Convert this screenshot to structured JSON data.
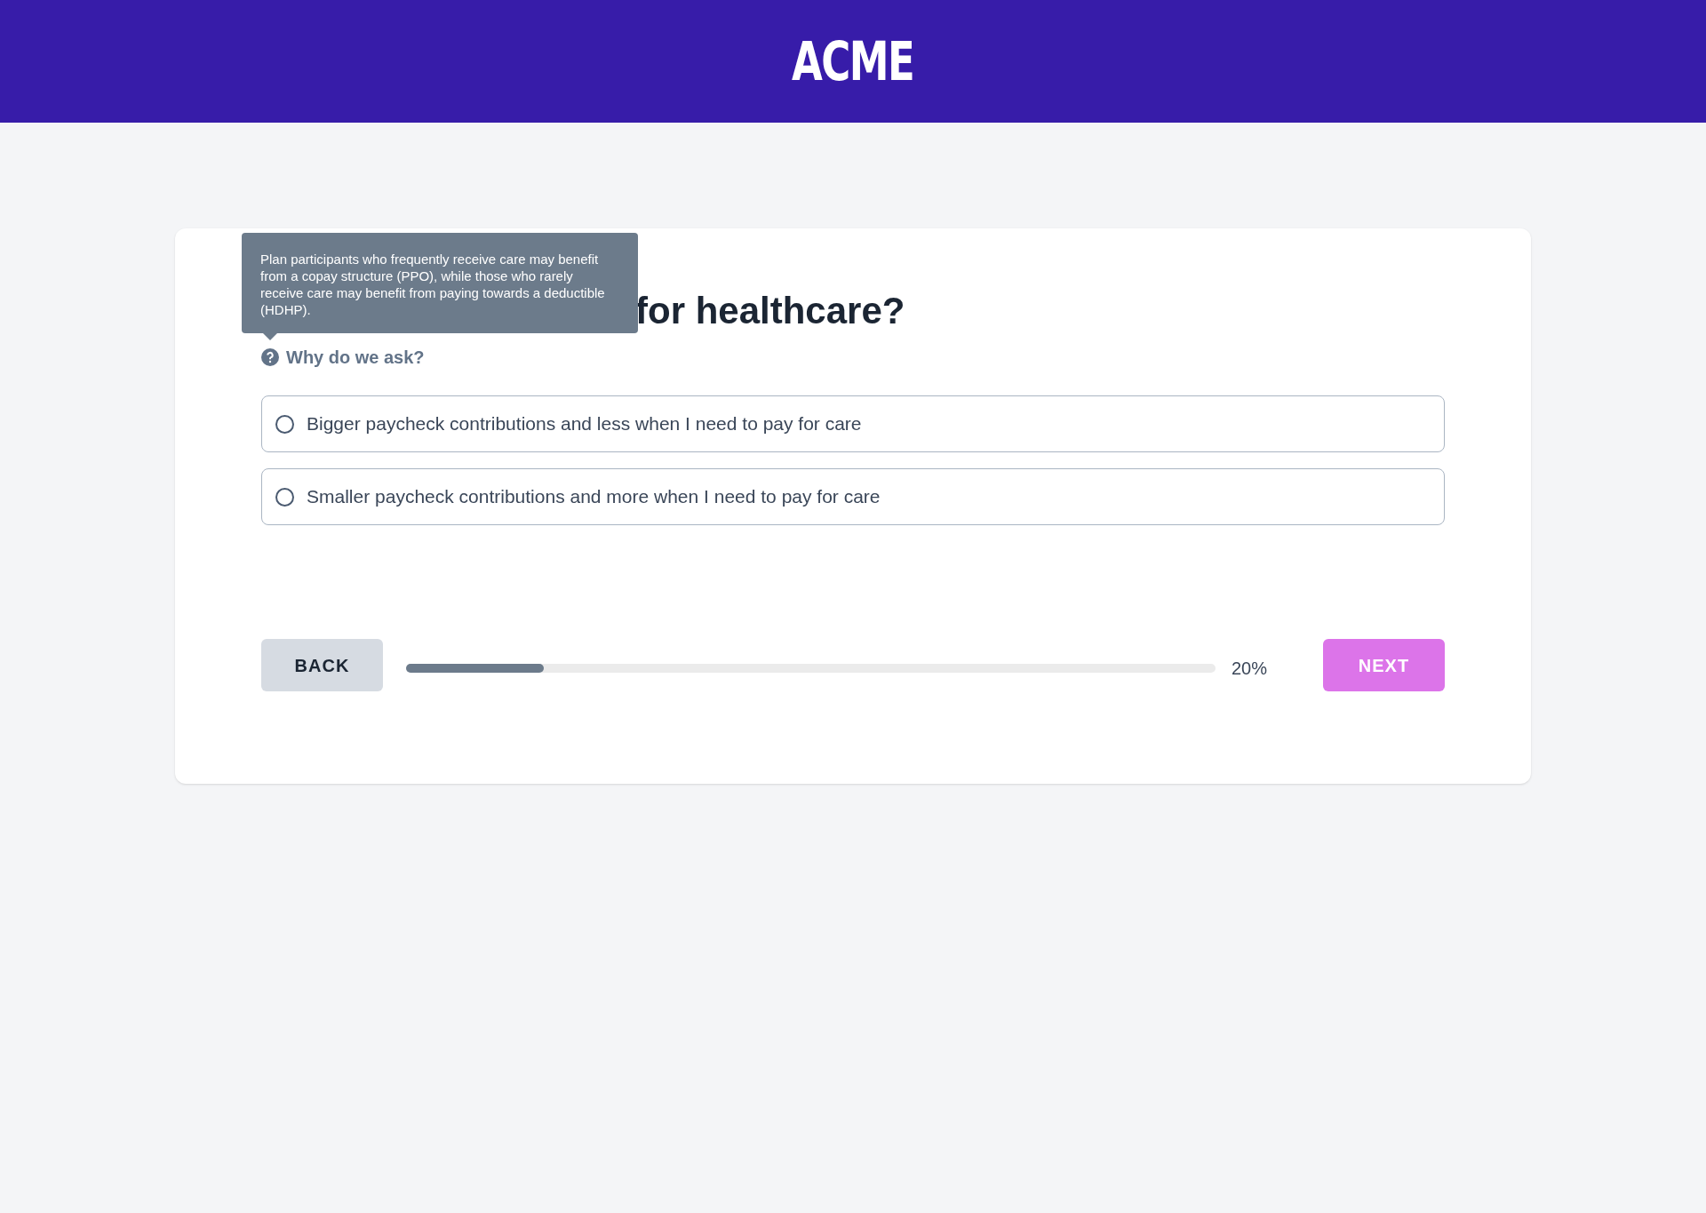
{
  "header": {
    "logo": "ACME"
  },
  "question": {
    "title_visible": "for healthcare?",
    "help_link": "Why do we ask?",
    "tooltip": "Plan participants who frequently receive care may benefit from a copay structure (PPO), while those who rarely receive care may benefit from paying towards a deductible (HDHP)."
  },
  "options": [
    {
      "label": "Bigger paycheck contributions and less when I need to pay for care",
      "selected": false
    },
    {
      "label": "Smaller paycheck contributions and more when I need to pay for care",
      "selected": false
    }
  ],
  "footer": {
    "back": "BACK",
    "next": "NEXT",
    "progress": {
      "level": 0.17,
      "reading": "20%"
    }
  }
}
